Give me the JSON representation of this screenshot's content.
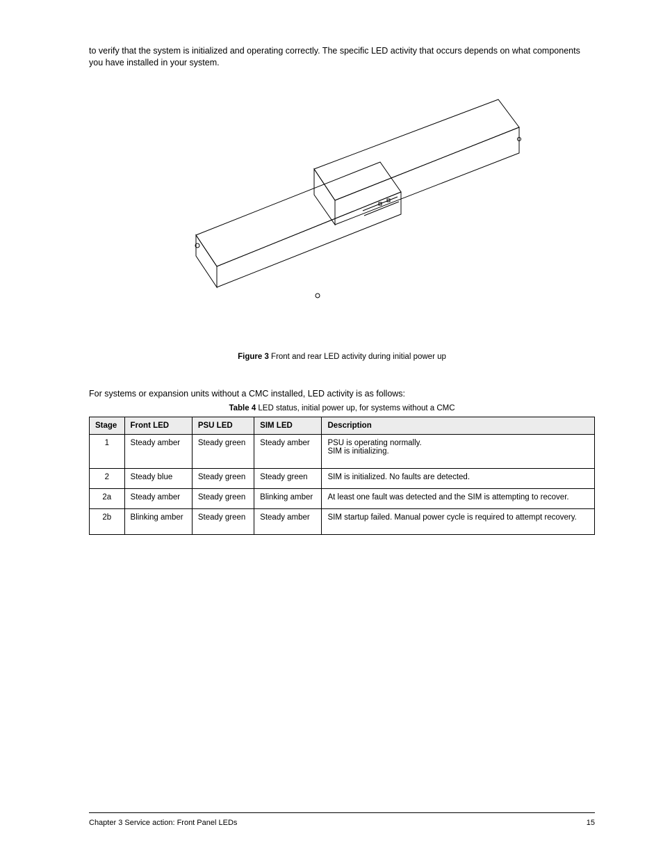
{
  "intro_para": "to verify that the system is initialized and operating correctly. The specific LED activity that occurs depends on what components you have installed in your system.",
  "figure": {
    "label_bold": "Figure 3",
    "label_rest": " Front and rear LED activity during initial power up"
  },
  "table_intro": "For systems or expansion units without a CMC installed, LED activity is as follows:",
  "table_caption": {
    "label_bold": "Table 4",
    "label_rest": " LED status, initial power up, for systems without a CMC"
  },
  "table": {
    "headers": [
      "Stage",
      "Front LED",
      "PSU LED",
      "SIM LED",
      "Description"
    ],
    "rows": [
      {
        "stage": "1",
        "front": "Steady amber",
        "psu": "Steady green",
        "sim": "Steady amber",
        "desc_lines": [
          "PSU is operating normally.",
          "SIM is initializing."
        ]
      },
      {
        "stage": "2",
        "front": "Steady blue",
        "psu": "Steady green",
        "sim": "Steady green",
        "desc_lines": [
          "SIM is initialized. No faults are detected."
        ]
      },
      {
        "stage": "2a",
        "front": "Steady amber",
        "psu": "Steady green",
        "sim": "Blinking amber",
        "desc_lines": [
          "At least one fault was detected and the SIM is attempting to recover."
        ]
      },
      {
        "stage": "2b",
        "front": "Blinking amber",
        "psu": "Steady green",
        "sim": "Steady amber",
        "desc_lines": [
          "SIM startup failed. Manual power cycle is required to attempt recovery."
        ]
      }
    ]
  },
  "footer": {
    "left": "Chapter 3 Service action: Front Panel LEDs",
    "right": "15"
  }
}
